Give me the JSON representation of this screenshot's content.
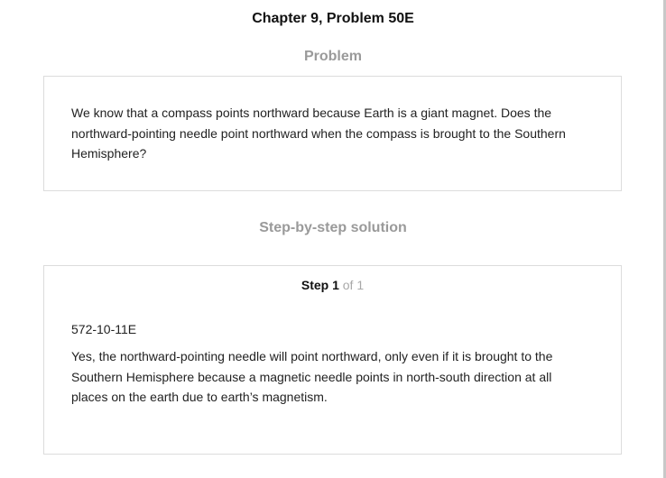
{
  "header": {
    "chapter_title": "Chapter 9, Problem 50E"
  },
  "problem": {
    "heading": "Problem",
    "text": "We know that a compass points northward because Earth is a giant magnet. Does the northward-pointing needle point northward when the compass is brought to the Southern Hemisphere?"
  },
  "solution": {
    "heading": "Step-by-step solution",
    "step": {
      "label": "Step 1",
      "of_label": " of 1",
      "code": "572-10-11E",
      "text": "Yes, the northward-pointing needle will point northward, only even if it is brought to the Southern Hemisphere because a magnetic needle points in north-south direction at all places on the earth due to earth’s magnetism."
    }
  }
}
